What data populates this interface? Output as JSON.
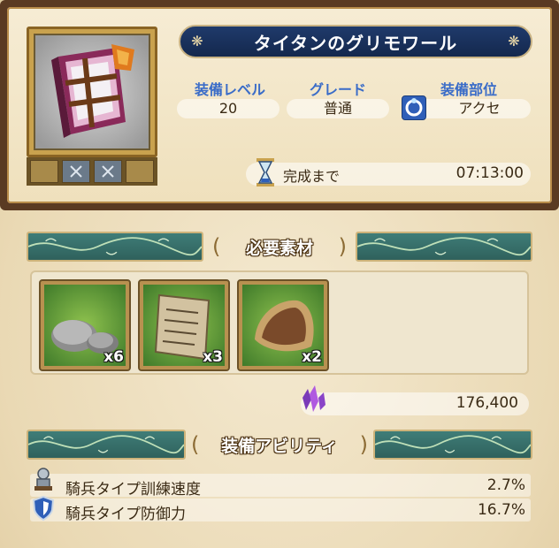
{
  "item": {
    "name": "タイタンのグリモワール",
    "icon": "grimoire-book-icon"
  },
  "stats": {
    "level_label": "装備レベル",
    "level_value": "20",
    "grade_label": "グレード",
    "grade_value": "普通",
    "slot_label": "装備部位",
    "slot_value": "アクセ",
    "slot_icon": "accessory-ring-icon"
  },
  "timer": {
    "label": "完成まで",
    "value": "07:13:00",
    "icon": "hourglass-icon"
  },
  "materials_section": {
    "title": "必要素材",
    "items": [
      {
        "icon": "stone-icon",
        "qty": "x6"
      },
      {
        "icon": "parchment-scroll-icon",
        "qty": "x3"
      },
      {
        "icon": "fur-pelt-icon",
        "qty": "x2"
      }
    ]
  },
  "cost": {
    "icon": "purple-crystal-icon",
    "value": "176,400"
  },
  "abilities_section": {
    "title": "装備アビリティ",
    "items": [
      {
        "icon": "cavalry-knight-icon",
        "name": "騎兵タイプ訓練速度",
        "value": "2.7%"
      },
      {
        "icon": "shield-icon",
        "name": "騎兵タイプ防御力",
        "value": "16.7%"
      }
    ]
  },
  "colors": {
    "title_bar": "#1f3a6b",
    "stat_label": "#3a6cc8",
    "header_teal": "#3f7d78",
    "frame_brown": "#5a3a22"
  }
}
